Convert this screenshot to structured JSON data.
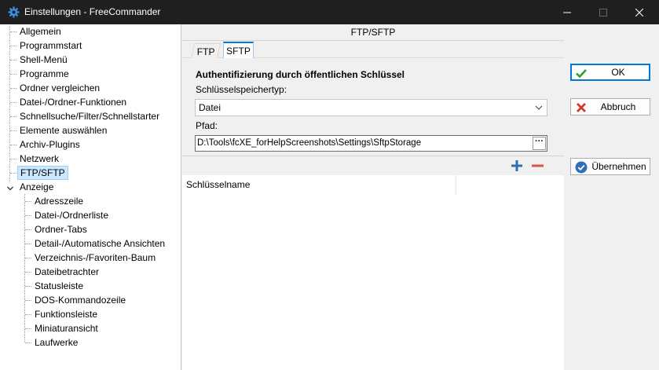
{
  "window": {
    "title": "Einstellungen - FreeCommander",
    "icon": "gear-icon"
  },
  "tree": {
    "items": [
      {
        "label": "Allgemein"
      },
      {
        "label": "Programmstart"
      },
      {
        "label": "Shell-Menü"
      },
      {
        "label": "Programme"
      },
      {
        "label": "Ordner vergleichen"
      },
      {
        "label": "Datei-/Ordner-Funktionen"
      },
      {
        "label": "Schnellsuche/Filter/Schnellstarter"
      },
      {
        "label": "Elemente auswählen"
      },
      {
        "label": "Archiv-Plugins"
      },
      {
        "label": "Netzwerk"
      },
      {
        "label": "FTP/SFTP",
        "selected": true
      },
      {
        "label": "Anzeige",
        "expanded": true
      },
      {
        "label": "Adresszeile"
      },
      {
        "label": "Datei-/Ordnerliste"
      },
      {
        "label": "Ordner-Tabs"
      },
      {
        "label": "Detail-/Automatische Ansichten"
      },
      {
        "label": "Verzeichnis-/Favoriten-Baum"
      },
      {
        "label": "Dateibetrachter"
      },
      {
        "label": "Statusleiste"
      },
      {
        "label": "DOS-Kommandozeile"
      },
      {
        "label": "Funktionsleiste"
      },
      {
        "label": "Miniaturansicht"
      },
      {
        "label": "Laufwerke"
      }
    ]
  },
  "main": {
    "header": "FTP/SFTP",
    "tabs": [
      {
        "label": "FTP",
        "active": false
      },
      {
        "label": "SFTP",
        "active": true
      }
    ],
    "section_title": "Authentifizierung durch öffentlichen Schlüssel",
    "storage_type_label": "Schlüsselspeichertyp:",
    "storage_type_value": "Datei",
    "path_label": "Pfad:",
    "path_value": "D:\\Tools\\fcXE_forHelpScreenshots\\Settings\\SftpStorage",
    "ellipsis_label": "···",
    "list": {
      "columns": [
        "Schlüsselname",
        ""
      ]
    }
  },
  "buttons": {
    "ok": "OK",
    "cancel": "Abbruch",
    "apply": "Übernehmen"
  },
  "colors": {
    "accent": "#0078d7",
    "add_icon": "#2f6fb5",
    "remove_icon": "#d9534f",
    "ok_check": "#2e9d3a",
    "cancel_x": "#d43a2a"
  }
}
